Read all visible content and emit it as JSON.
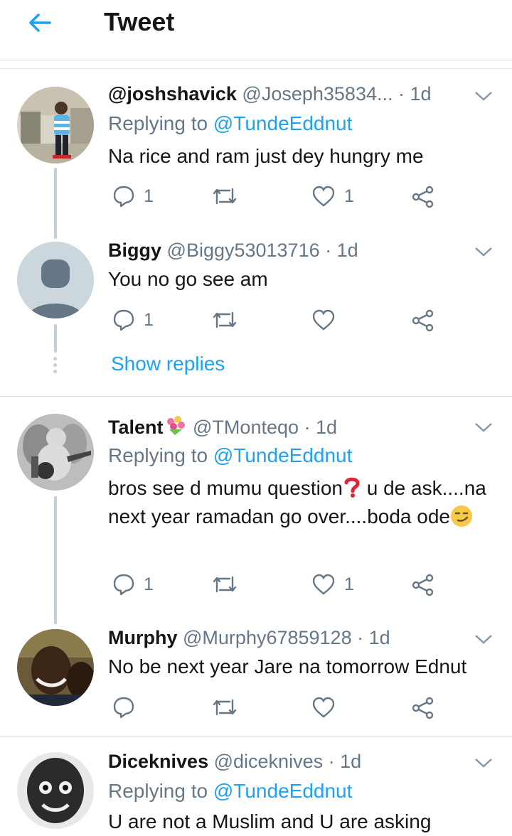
{
  "header": {
    "title": "Tweet"
  },
  "reply_prefix": "Replying to",
  "show_replies": "Show replies",
  "colors": {
    "accent": "#1da1f2",
    "secondary": "#657786",
    "text": "#14171a",
    "thread": "#c4cfd6"
  },
  "tweets": [
    {
      "name": "@joshshavick",
      "handle": "@Joseph35834...",
      "time": "· 1d",
      "mention": "@TundeEddnut",
      "text": "Na rice and ram just dey hungry me",
      "replies": "1",
      "likes": "1"
    },
    {
      "name": "Biggy",
      "handle": "@Biggy53013716",
      "time": "· 1d",
      "text": "You no go see am",
      "replies": "1",
      "likes": ""
    },
    {
      "name": "Talent",
      "handle": "@TMonteqo",
      "time": "· 1d",
      "mention": "@TundeEddnut",
      "text_a": "bros see d mumu question",
      "text_b": " u de ask....na next year ramadan go over....boda ode",
      "replies": "1",
      "likes": "1"
    },
    {
      "name": "Murphy",
      "handle": "@Murphy67859128",
      "time": "· 1d",
      "text": "No be next year Jare na tomorrow Ednut",
      "replies": "",
      "likes": ""
    },
    {
      "name": "Diceknives",
      "handle": "@diceknives",
      "time": "· 1d",
      "mention": "@TundeEddnut",
      "text": "U are not a Muslim and U are asking"
    }
  ]
}
